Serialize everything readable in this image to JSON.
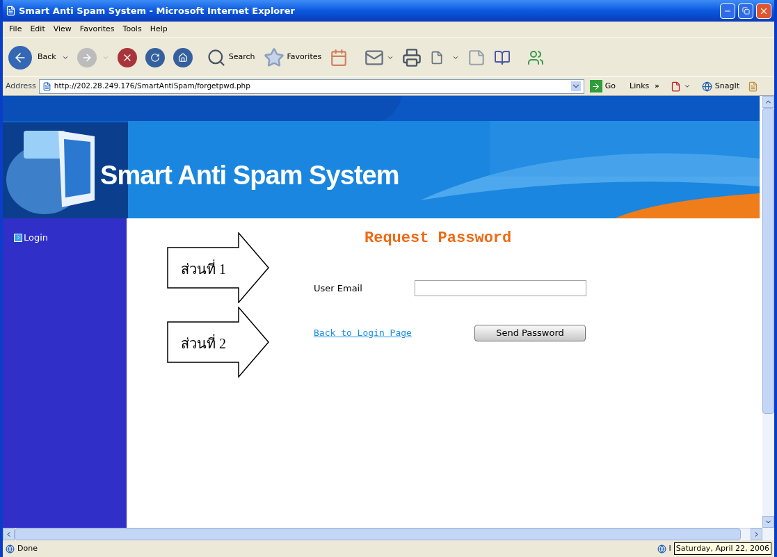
{
  "window": {
    "title": "Smart Anti Spam System - Microsoft Internet Explorer"
  },
  "menu": [
    "File",
    "Edit",
    "View",
    "Favorites",
    "Tools",
    "Help"
  ],
  "toolbar": {
    "back": "Back",
    "search": "Search",
    "favorites": "Favorites"
  },
  "address_bar": {
    "label": "Address",
    "url": "http://202.28.249.176/SmartAntiSpam/forgetpwd.php",
    "go": "Go",
    "links": "Links",
    "links_more": "»",
    "snagit": "SnagIt"
  },
  "page": {
    "banner_title": "Smart Anti Spam System",
    "sidebar": [
      {
        "label": "Login"
      }
    ],
    "heading": "Request Password",
    "email_label": "User Email",
    "back_link": "Back to Login Page",
    "submit": "Send Password"
  },
  "callouts": [
    {
      "label": "ส่วนที่ 1"
    },
    {
      "label": "ส่วนที่ 2"
    }
  ],
  "status_bar": {
    "status": "Done",
    "zone": "I",
    "tooltip": "Saturday, April 22, 2006"
  }
}
